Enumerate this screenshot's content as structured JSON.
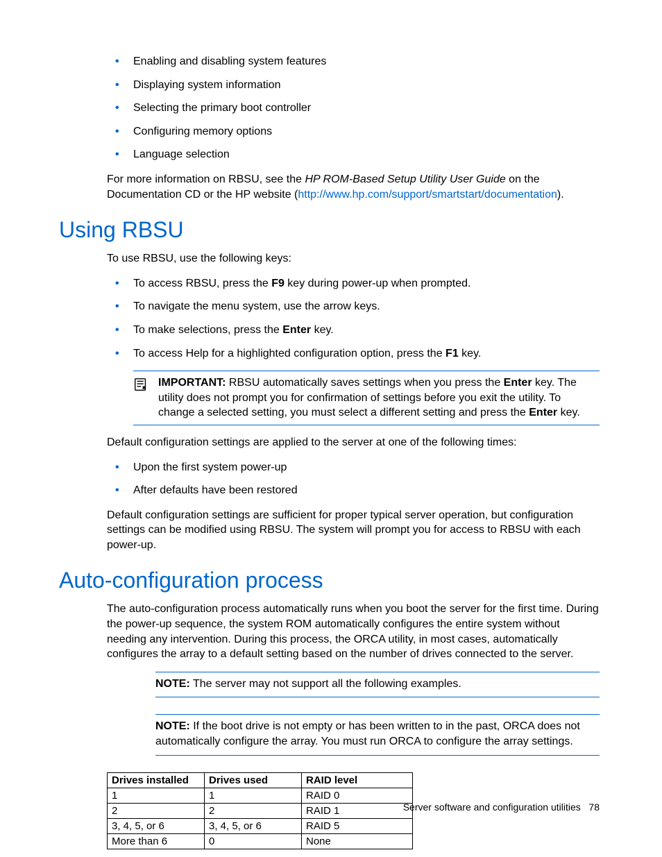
{
  "intro": {
    "bullets": [
      "Enabling and disabling system features",
      "Displaying system information",
      "Selecting the primary boot controller",
      "Configuring memory options",
      "Language selection"
    ],
    "more_info_prefix": "For more information on RBSU, see the ",
    "more_info_italic": "HP ROM-Based Setup Utility User Guide",
    "more_info_mid": " on the Documentation CD or the HP website (",
    "more_info_link": "http://www.hp.com/support/smartstart/documentation",
    "more_info_suffix": ")."
  },
  "using_rbsu": {
    "heading": "Using RBSU",
    "intro": "To use RBSU, use the following keys:",
    "bullets": [
      {
        "pre": "To access RBSU, press the ",
        "bold": "F9",
        "post": " key during power-up when prompted."
      },
      {
        "pre": "To navigate the menu system, use the arrow keys.",
        "bold": "",
        "post": ""
      },
      {
        "pre": "To make selections, press the ",
        "bold": "Enter",
        "post": " key."
      },
      {
        "pre": "To access Help for a highlighted configuration option, press the ",
        "bold": "F1",
        "post": " key."
      }
    ],
    "important_label": "IMPORTANT:",
    "important_pre": "  RBSU automatically saves settings when you press the ",
    "important_bold1": "Enter",
    "important_mid": " key. The utility does not prompt you for confirmation of settings before you exit the utility. To change a selected setting, you must select a different setting and press the ",
    "important_bold2": "Enter",
    "important_post": " key.",
    "defaults_intro": "Default configuration settings are applied to the server at one of the following times:",
    "defaults_bullets": [
      "Upon the first system power-up",
      "After defaults have been restored"
    ],
    "defaults_outro": "Default configuration settings are sufficient for proper typical server operation, but configuration settings can be modified using RBSU. The system will prompt you for access to RBSU with each power-up."
  },
  "auto_config": {
    "heading": "Auto-configuration process",
    "intro": "The auto-configuration process automatically runs when you boot the server for the first time. During the power-up sequence, the system ROM automatically configures the entire system without needing any intervention. During this process, the ORCA utility, in most cases, automatically configures the array to a default setting based on the number of drives connected to the server.",
    "note1_label": "NOTE:",
    "note1_text": "  The server may not support all the following examples.",
    "note2_label": "NOTE:",
    "note2_text": "  If the boot drive is not empty or has been written to in the past, ORCA does not automatically configure the array. You must run ORCA to configure the array settings.",
    "table": {
      "headers": [
        "Drives installed",
        "Drives used",
        "RAID level"
      ],
      "rows": [
        [
          "1",
          "1",
          "RAID 0"
        ],
        [
          "2",
          "2",
          "RAID 1"
        ],
        [
          "3, 4, 5, or 6",
          "3, 4, 5, or 6",
          "RAID 5"
        ],
        [
          "More than 6",
          "0",
          "None"
        ]
      ]
    }
  },
  "footer": {
    "section": "Server software and configuration utilities",
    "page": "78"
  },
  "chart_data": {
    "type": "table",
    "title": "RAID configuration by drive count",
    "headers": [
      "Drives installed",
      "Drives used",
      "RAID level"
    ],
    "rows": [
      [
        "1",
        "1",
        "RAID 0"
      ],
      [
        "2",
        "2",
        "RAID 1"
      ],
      [
        "3, 4, 5, or 6",
        "3, 4, 5, or 6",
        "RAID 5"
      ],
      [
        "More than 6",
        "0",
        "None"
      ]
    ]
  }
}
